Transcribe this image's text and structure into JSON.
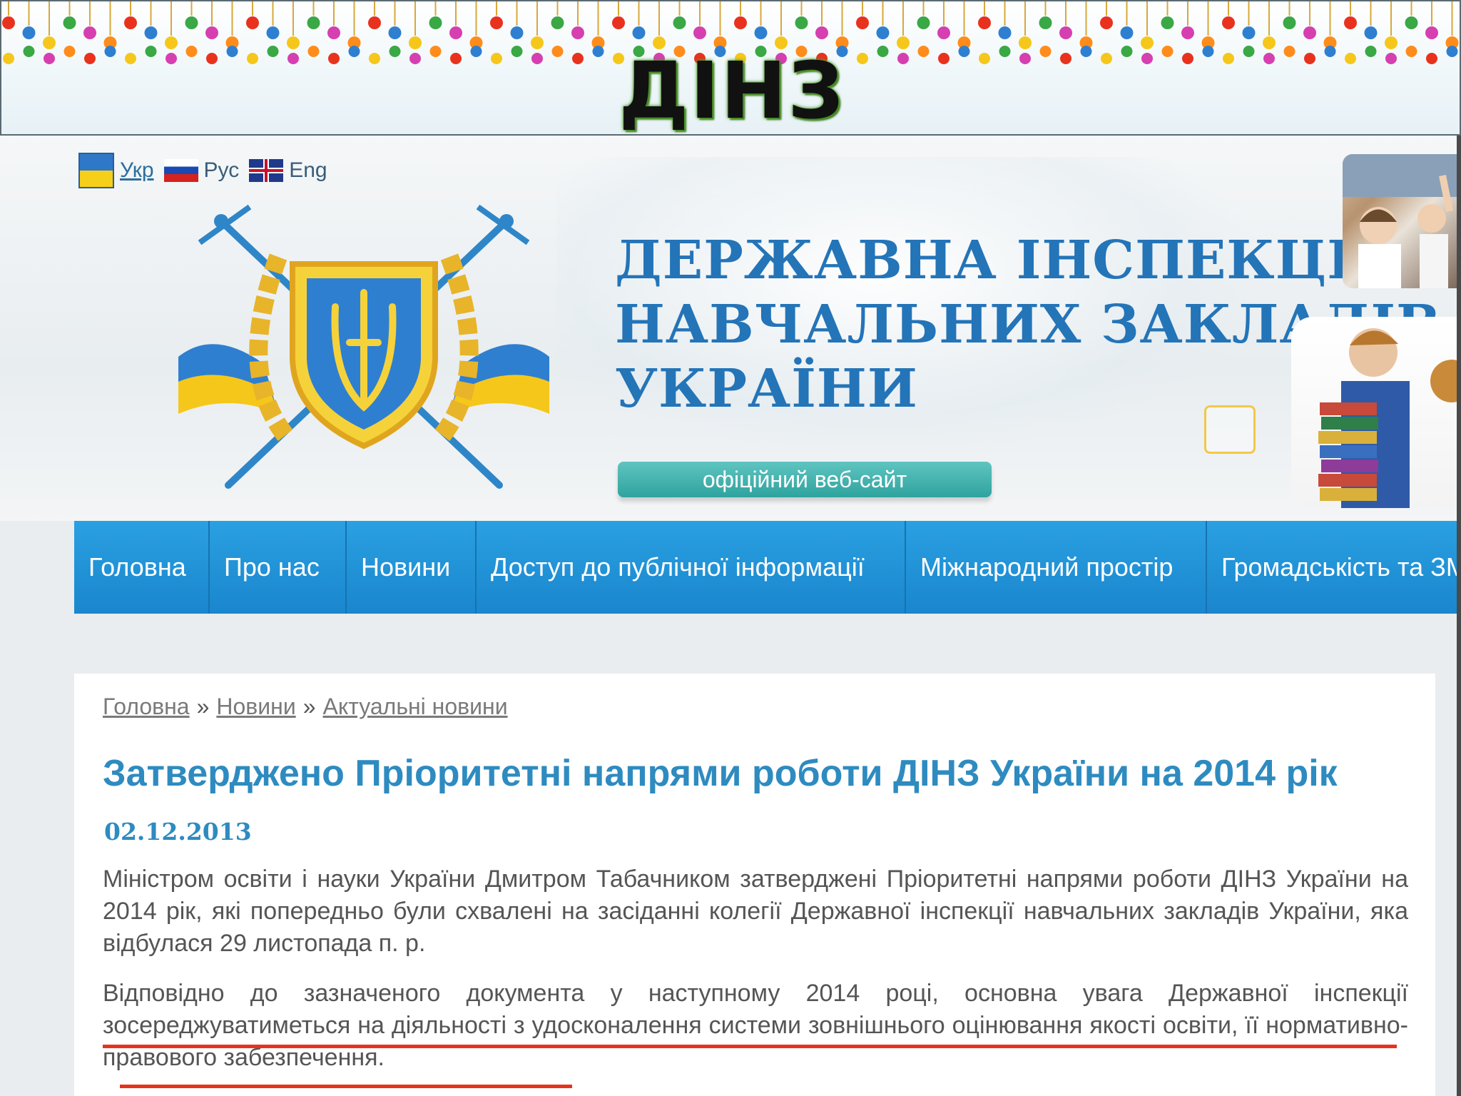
{
  "slide": {
    "title": "ДІНЗ"
  },
  "languages": [
    {
      "label": "Укр",
      "active": true
    },
    {
      "label": "Рус",
      "active": false
    },
    {
      "label": "Eng",
      "active": false
    }
  ],
  "header": {
    "org_name_lines": [
      "ДЕРЖАВНА ІНСПЕКЦІЯ",
      "НАВЧАЛЬНИХ ЗАКЛАДІВ",
      "УКРАЇНИ"
    ],
    "official_label": "офіційний веб-сайт"
  },
  "nav": {
    "items": [
      "Головна",
      "Про нас",
      "Новини",
      "Доступ до публічної інформації",
      "Міжнародний простір",
      "Громадськість та ЗМІ"
    ]
  },
  "breadcrumb": [
    "Головна",
    "Новини",
    "Актуальні новини"
  ],
  "breadcrumb_sep": "»",
  "article": {
    "title": "Затверджено Пріоритетні напрями роботи ДІНЗ України на 2014 рік",
    "date": "02.12.2013",
    "paragraphs": [
      "Міністром освіти і науки України Дмитром Табачником затверджені Пріоритетні напрями роботи ДІНЗ України на 2014 рік, які попередньо були схвалені на засіданні колегії Державної інспекції навчальних закладів України, яка відбулася 29 листопада п. р.",
      "Відповідно до зазначеного документа у наступному 2014 році, основна увага Державної інспекції зосереджуватиметься на діяльності з удосконалення системи зовнішнього оцінювання якості освіти, її нормативно-правового забезпечення."
    ]
  },
  "colors": {
    "accent": "#2474b8",
    "nav": "#1a86cd",
    "highlight": "#e8321e",
    "teal": "#2fa39f"
  }
}
